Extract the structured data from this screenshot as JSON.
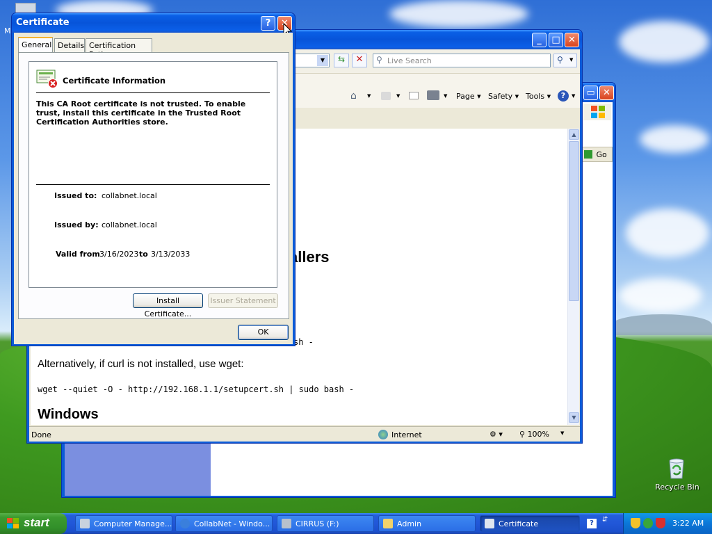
{
  "desktop": {
    "recycle_bin_label": "Recycle Bin",
    "partial_icon_label": "M"
  },
  "ie_window": {
    "search_placeholder": "Live Search",
    "toolbar": {
      "page": "Page",
      "safety": "Safety",
      "tools": "Tools"
    },
    "content": {
      "heading_installers_partial": "allers",
      "curl_command_partial": "sh -",
      "alt_text": "Alternatively, if curl is not installed, use wget:",
      "wget_command": "wget --quiet -O - http://192.168.1.1/setupcert.sh | sudo bash -",
      "heading_windows": "Windows"
    },
    "status": {
      "left": "Done",
      "zone": "Internet",
      "zoom": "100%"
    }
  },
  "back_window": {
    "go_label": "Go"
  },
  "certificate_dialog": {
    "title": "Certificate",
    "help_btn": "?",
    "tabs": [
      "General",
      "Details",
      "Certification Path"
    ],
    "info_title": "Certificate Information",
    "warning": "This CA Root certificate is not trusted. To enable trust, install this certificate in the Trusted Root Certification Authorities store.",
    "issued_to_label": "Issued to:",
    "issued_to_value": "collabnet.local",
    "issued_by_label": "Issued by:",
    "issued_by_value": "collabnet.local",
    "valid_from_label": "Valid from",
    "valid_from_value": "3/16/2023",
    "valid_to_label": "to",
    "valid_to_value": "3/13/2033",
    "install_btn": "Install Certificate...",
    "issuer_btn": "Issuer Statement",
    "ok_btn": "OK"
  },
  "taskbar": {
    "start_label": "start",
    "tasks": [
      "Computer Manage...",
      "CollabNet - Windo...",
      "CIRRUS (F:)",
      "Admin",
      "Certificate"
    ],
    "clock": "3:22 AM"
  },
  "colors": {
    "xp_blue": "#0b5bd8",
    "start_green": "#3c9a2f",
    "dialog_bg": "#ece9d8"
  }
}
